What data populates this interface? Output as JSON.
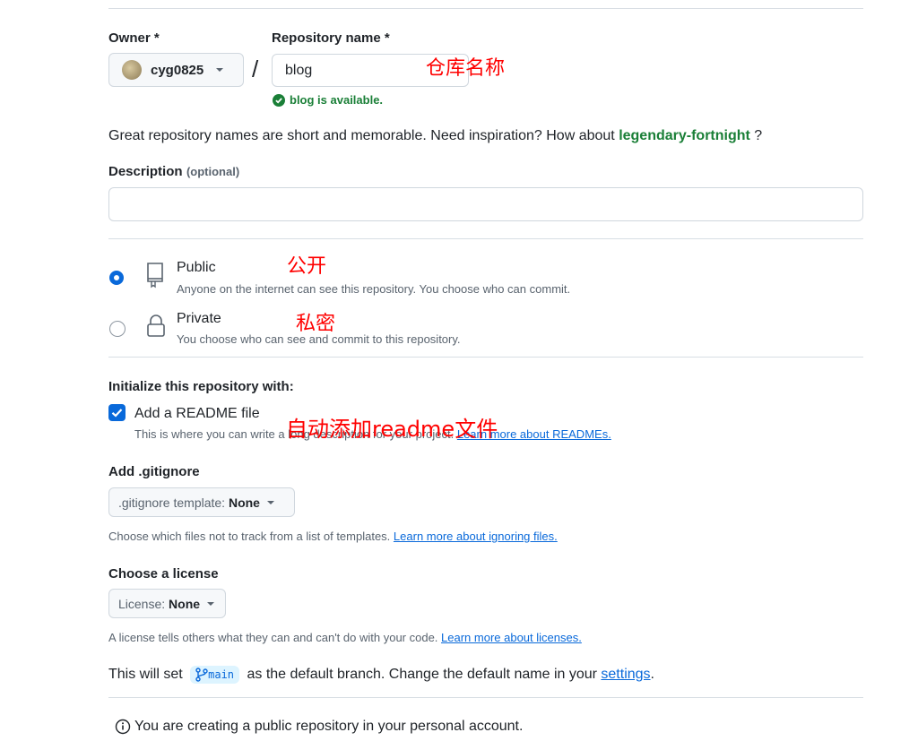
{
  "owner": {
    "label": "Owner *",
    "value": "cyg0825"
  },
  "repo": {
    "label": "Repository name *",
    "value": "blog",
    "status": "blog is available.",
    "annotation": "仓库名称"
  },
  "inspiration": {
    "text": "Great repository names are short and memorable. Need inspiration? How about ",
    "suggestion": "legendary-fortnight",
    "suffix": " ?"
  },
  "description": {
    "label": "Description",
    "optional": "(optional)",
    "value": ""
  },
  "visibility": {
    "public": {
      "title": "Public",
      "desc": "Anyone on the internet can see this repository. You choose who can commit.",
      "annotation": "公开",
      "selected": true
    },
    "private": {
      "title": "Private",
      "desc": "You choose who can see and commit to this repository.",
      "annotation": "私密",
      "selected": false
    }
  },
  "init": {
    "heading": "Initialize this repository with:",
    "readme_label": "Add a README file",
    "readme_desc": "This is where you can write a long description for your project.",
    "readme_link": "Learn more about READMEs.",
    "readme_annotation": "自动添加readme文件",
    "readme_checked": true
  },
  "gitignore": {
    "heading": "Add .gitignore",
    "button_prefix": ".gitignore template: ",
    "button_value": "None",
    "desc": "Choose which files not to track from a list of templates. ",
    "link": "Learn more about ignoring files."
  },
  "license": {
    "heading": "Choose a license",
    "button_prefix": "License: ",
    "button_value": "None",
    "desc": "A license tells others what they can and can't do with your code. ",
    "link": "Learn more about licenses."
  },
  "branch": {
    "prefix": "This will set ",
    "name": "main",
    "middle": " as the default branch. Change the default name in your ",
    "link": "settings",
    "suffix": "."
  },
  "footer_note": "You are creating a public repository in your personal account.",
  "colors": {
    "accent": "#0969da",
    "success": "#1a7f37",
    "annotation": "#ff0000"
  }
}
